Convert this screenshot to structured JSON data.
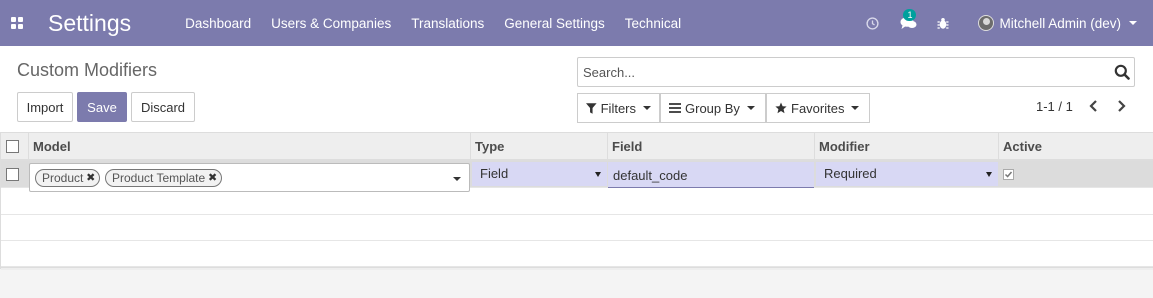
{
  "navbar": {
    "app_title": "Settings",
    "menu": [
      "Dashboard",
      "Users & Companies",
      "Translations",
      "General Settings",
      "Technical"
    ],
    "messages_badge": "1",
    "user_name": "Mitchell Admin (dev)",
    "icons": [
      "apps-grid-icon",
      "clock-icon",
      "chat-icon",
      "bug-icon",
      "avatar",
      "chevron-down-icon"
    ]
  },
  "control_panel": {
    "title": "Custom Modifiers",
    "buttons": {
      "import": "Import",
      "save": "Save",
      "discard": "Discard"
    },
    "search": {
      "placeholder": "Search...",
      "value": ""
    },
    "filters": {
      "filters": "Filters",
      "group_by": "Group By",
      "favorites": "Favorites"
    },
    "pager": "1-1 / 1"
  },
  "list": {
    "columns": [
      "Model",
      "Type",
      "Field",
      "Modifier",
      "Active"
    ],
    "edit_row": {
      "model_tags": [
        "Product",
        "Product Template"
      ],
      "type": "Field",
      "field": "default_code",
      "modifier": "Required",
      "active": true
    }
  },
  "colors": {
    "brand": "#7c7bad",
    "edit_cell": "#d8d8f4",
    "badge": "#00a09d"
  }
}
